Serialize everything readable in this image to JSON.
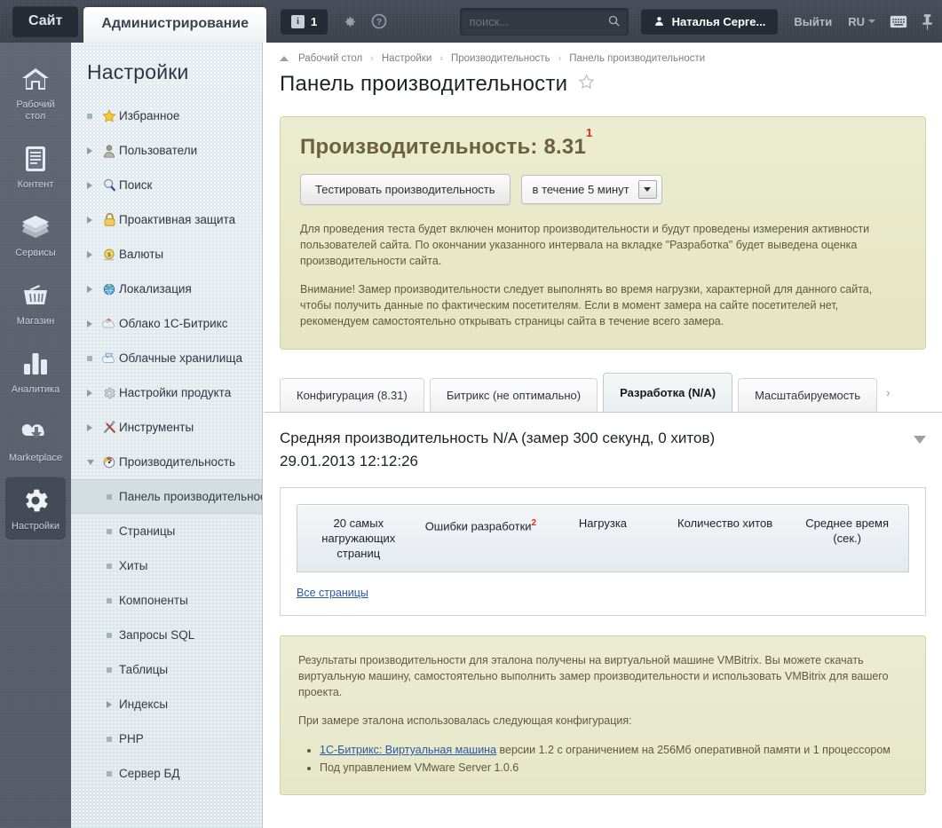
{
  "topbar": {
    "site_tab": "Сайт",
    "admin_tab": "Администрирование",
    "notif_count": "1",
    "notif_icon_letter": "i",
    "gear_icon": "gear-icon",
    "help_icon": "question-icon",
    "search_placeholder": "поиск...",
    "search_value": "",
    "user_name": "Наталья Серге...",
    "logout": "Выйти",
    "lang": "RU",
    "keyboard_icon": "keyboard-icon",
    "pin_icon": "pin-icon"
  },
  "rail": {
    "items": [
      {
        "label": "Рабочий стол",
        "icon": "home-icon",
        "active": false
      },
      {
        "label": "Контент",
        "icon": "document-icon",
        "active": false
      },
      {
        "label": "Сервисы",
        "icon": "layers-icon",
        "active": false
      },
      {
        "label": "Магазин",
        "icon": "basket-icon",
        "active": false
      },
      {
        "label": "Аналитика",
        "icon": "bar-chart-icon",
        "active": false
      },
      {
        "label": "Marketplace",
        "icon": "cloud-download-icon",
        "active": false
      },
      {
        "label": "Настройки",
        "icon": "gear-icon",
        "active": true
      }
    ]
  },
  "tree": {
    "title": "Настройки",
    "items": [
      {
        "label": "Избранное",
        "marker": "square",
        "icon": "star-icon",
        "level": 0
      },
      {
        "label": "Пользователи",
        "marker": "right",
        "icon": "user-icon",
        "level": 0
      },
      {
        "label": "Поиск",
        "marker": "right",
        "icon": "magnifier-icon",
        "level": 0
      },
      {
        "label": "Проактивная защита",
        "marker": "right",
        "icon": "lock-icon",
        "level": 0
      },
      {
        "label": "Валюты",
        "marker": "right",
        "icon": "coin-icon",
        "level": 0
      },
      {
        "label": "Локализация",
        "marker": "right",
        "icon": "globe-icon",
        "level": 0
      },
      {
        "label": "Облако 1С-Битрикс",
        "marker": "right",
        "icon": "cloud-red-icon",
        "level": 0
      },
      {
        "label": "Облачные хранилища",
        "marker": "square",
        "icon": "cloud-blue-icon",
        "level": 0
      },
      {
        "label": "Настройки продукта",
        "marker": "right",
        "icon": "gear-icon",
        "level": 0
      },
      {
        "label": "Инструменты",
        "marker": "right",
        "icon": "tools-icon",
        "level": 0
      },
      {
        "label": "Производительность",
        "marker": "down",
        "icon": "speedometer-icon",
        "level": 0
      },
      {
        "label": "Панель производительнос",
        "marker": "square",
        "icon": "",
        "level": 1,
        "selected": true
      },
      {
        "label": "Страницы",
        "marker": "square",
        "icon": "",
        "level": 1
      },
      {
        "label": "Хиты",
        "marker": "square",
        "icon": "",
        "level": 1
      },
      {
        "label": "Компоненты",
        "marker": "square",
        "icon": "",
        "level": 1
      },
      {
        "label": "Запросы SQL",
        "marker": "square",
        "icon": "",
        "level": 1
      },
      {
        "label": "Таблицы",
        "marker": "square",
        "icon": "",
        "level": 1
      },
      {
        "label": "Индексы",
        "marker": "right",
        "icon": "",
        "level": 1
      },
      {
        "label": "PHP",
        "marker": "square",
        "icon": "",
        "level": 1
      },
      {
        "label": "Сервер БД",
        "marker": "square",
        "icon": "",
        "level": 1
      }
    ]
  },
  "breadcrumb": {
    "items": [
      "Рабочий стол",
      "Настройки",
      "Производительность",
      "Панель производительности"
    ],
    "separator": "›"
  },
  "page": {
    "title": "Панель производительности",
    "star_icon": "star-outline-icon"
  },
  "perf_panel": {
    "heading_label": "Производительность:",
    "score": "8.31",
    "footnote": "1",
    "test_button": "Тестировать производительность",
    "interval_value": "в течение 5 минут",
    "paragraph_1": "Для проведения теста будет включен монитор производительности и будут проведены измерения активности пользователей сайта. По окончании указанного интервала на вкладке \"Разработка\" будет выведена оценка производительности сайта.",
    "paragraph_2": "Внимание! Замер производительности следует выполнять во время нагрузки, характерной для данного сайта, чтобы получить данные по фактическим посетителям. Если в момент замера на сайте посетителей нет, рекомендуем самостоятельно открывать страницы сайта в течение всего замера."
  },
  "tabs": {
    "items": [
      {
        "label": "Конфигурация (8.31)",
        "active": false
      },
      {
        "label": "Битрикс (не оптимально)",
        "active": false
      },
      {
        "label": "Разработка (N/A)",
        "active": true
      },
      {
        "label": "Масштабируемость",
        "active": false
      }
    ],
    "more_arrow": "›"
  },
  "summary": {
    "line1": "Средняя производительность N/A (замер 300 секунд, 0 хитов)",
    "line2": "29.01.2013 12:12:26",
    "collapse_icon": "triangle-down-icon"
  },
  "table": {
    "headers": [
      {
        "label": "20 самых нагружающих страниц",
        "sup": ""
      },
      {
        "label": "Ошибки разработки",
        "sup": "2"
      },
      {
        "label": "Нагрузка",
        "sup": ""
      },
      {
        "label": "Количество хитов",
        "sup": ""
      },
      {
        "label": "Среднее время (сек.)",
        "sup": ""
      }
    ],
    "rows": [],
    "all_pages_link": "Все страницы"
  },
  "note": {
    "paragraph_1": "Результаты производительности для эталона получены на виртуальной машине VMBitrix. Вы можете скачать виртуальную машину, самостоятельно выполнить замер производительности и использовать VMBitrix для вашего проекта.",
    "paragraph_2": "При замере эталона использовалась следующая конфигурация:",
    "bullet_1_link": "1С-Битрикс: Виртуальная машина",
    "bullet_1_rest": " версии 1.2 с ограничением на 256Мб оперативной памяти и 1 процессором",
    "bullet_2": "Под управлением VMware Server 1.0.6"
  },
  "colors": {
    "topbar": "#3f4450",
    "rail": "#5b616e",
    "tree": "#e3ebee",
    "yellow_panel": "#e9e9cb",
    "link": "#2a59a8",
    "footnote_red": "#d42e1c"
  }
}
